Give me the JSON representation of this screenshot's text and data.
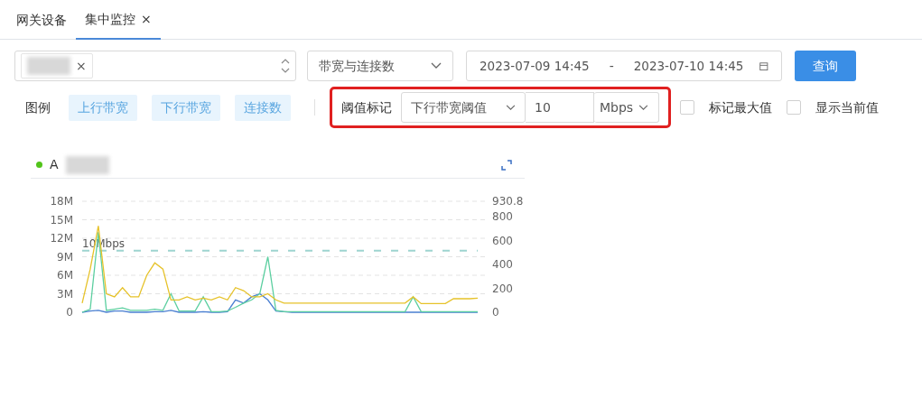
{
  "tabs": [
    {
      "label": "网关设备",
      "selected": false
    },
    {
      "label": "集中监控",
      "close": "×",
      "selected": true
    }
  ],
  "filters": {
    "device_select": {
      "chip_close": "×"
    },
    "metric_select": {
      "value": "带宽与连接数"
    },
    "date_range": {
      "start": "2023-07-09 14:45",
      "separator": "-",
      "end": "2023-07-10 14:45"
    },
    "query_button": "查询"
  },
  "legend": {
    "label": "图例"
  },
  "threshold": {
    "highlighted": true,
    "label": "阈值标记",
    "type": "下行带宽阈值",
    "value": "10",
    "unit": "Mbps"
  },
  "options": [
    {
      "label": "标记最大值",
      "checked": false
    },
    {
      "label": "显示当前值",
      "checked": false
    }
  ],
  "card": {
    "title": "A",
    "chart_data": {
      "type": "line",
      "grid": true,
      "ref_lines": [
        {
          "axis": "y",
          "value": 10,
          "label": "10Mbps"
        }
      ],
      "ylim": [
        0,
        18
      ],
      "yticks": [
        {
          "value": 0,
          "label": "0"
        },
        {
          "value": 3,
          "label": "3M"
        },
        {
          "value": 6,
          "label": "6M"
        },
        {
          "value": 9,
          "label": "9M"
        },
        {
          "value": 12,
          "label": "12M"
        },
        {
          "value": 15,
          "label": "15M"
        },
        {
          "value": 18,
          "label": "18M"
        }
      ],
      "y2lim": [
        0,
        930.8
      ],
      "y2ticks": [
        0,
        200,
        400,
        600,
        800,
        930.8
      ],
      "series": [
        {
          "name": "上行带宽",
          "color": "#4a7fd1",
          "values": [
            0,
            0.2,
            0.3,
            0,
            0.2,
            0.2,
            0,
            0,
            0,
            0.1,
            0.1,
            0.3,
            0,
            0,
            0,
            0.1,
            0,
            0,
            0.1,
            2,
            1.5,
            2.5,
            3,
            2,
            0.2,
            0.1,
            0,
            0,
            0,
            0,
            0,
            0,
            0,
            0,
            0,
            0,
            0,
            0,
            0,
            0,
            0,
            0,
            0,
            0,
            0,
            0,
            0,
            0,
            0,
            0
          ]
        },
        {
          "name": "下行带宽",
          "color": "#5ccfa0",
          "values": [
            0,
            0.5,
            13,
            0.3,
            0.5,
            0.7,
            0.3,
            0.3,
            0.3,
            0.5,
            0.3,
            3,
            0.2,
            0.2,
            0.2,
            2.5,
            0.1,
            0.1,
            0.2,
            0.8,
            1.5,
            2,
            3,
            9,
            0.3,
            0.1,
            0.1,
            0.1,
            0.1,
            0.1,
            0.1,
            0.1,
            0.1,
            0.1,
            0.1,
            0.1,
            0.1,
            0.1,
            0.1,
            0.1,
            0.1,
            2.5,
            0.1,
            0.1,
            0.1,
            0.1,
            0.1,
            0.1,
            0.1,
            0.1
          ]
        },
        {
          "name": "连接数",
          "color": "#e6c229",
          "values": [
            1.5,
            7,
            14,
            3,
            2.5,
            4,
            2.5,
            2.5,
            6,
            8,
            7,
            2,
            2,
            2.5,
            2,
            2.3,
            2,
            2.5,
            2,
            4,
            3.5,
            2.5,
            2.5,
            3,
            2,
            1.5,
            1.5,
            1.5,
            1.5,
            1.5,
            1.5,
            1.5,
            1.5,
            1.5,
            1.5,
            1.5,
            1.5,
            1.5,
            1.5,
            1.5,
            1.5,
            2.5,
            1.4,
            1.4,
            1.4,
            1.4,
            2.2,
            2.2,
            2.2,
            2.3
          ]
        }
      ]
    }
  }
}
